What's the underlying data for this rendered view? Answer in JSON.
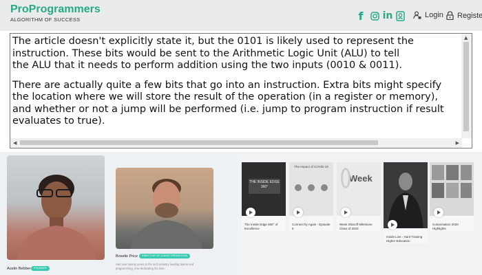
{
  "header": {
    "logo_title": "ProProgrammers",
    "logo_subtitle": "ALGORITHM OF SUCCESS",
    "social_icons": [
      "facebook-icon",
      "instagram-icon",
      "linkedin-icon",
      "badge-icon"
    ],
    "facebook_glyph": "f",
    "linkedin_glyph": "in",
    "login_label": "Login",
    "register_label": "Register"
  },
  "article": {
    "paragraphs": [
      [
        "The article doesn't explicitly state it, but the 0101 is likely used to represent the",
        "instruction. These bits would be sent to the Arithmetic Logic Unit (ALU) to tell",
        "the ALU that it needs to perform addition using the two inputs (0010 & 0011)."
      ],
      [
        "There are actually quite a few bits that go into an instruction. Extra bits might specify",
        "the location where we will store the result of the operation (in a register or memory),",
        "and whether or not a jump will be performed (i.e. jump to program instruction if result",
        "evaluates to true)."
      ]
    ]
  },
  "people": [
    {
      "name": "Austin Bebber",
      "tag": "FOUNDER"
    },
    {
      "name": "Bowdie Price",
      "tag": "DIRECTOR OF CLIENT OPERATIONS",
      "desc": "Has over twenty years in the tech industry leading teams and programming, now dedicating his time."
    }
  ],
  "videos": [
    {
      "title": "The Inside Edge 360° of Excellence",
      "thumb_text": "THE INSIDE EDGE 360°"
    },
    {
      "title": "Connect by Again - Episode 5",
      "thumb_text": "The Impact of COVID-19"
    },
    {
      "title": "Week Sharoff Milestone Class of 2020",
      "thumb_text": "Week"
    },
    {
      "title": "Inside Live - Hunt Training Higher Education",
      "thumb_text": ""
    },
    {
      "title": "Conversation 2020 Highlights",
      "thumb_text": ""
    }
  ],
  "colors": {
    "brand": "#27a987",
    "header_bg": "#e9eceb",
    "tag_bg": "#39c9b0"
  }
}
